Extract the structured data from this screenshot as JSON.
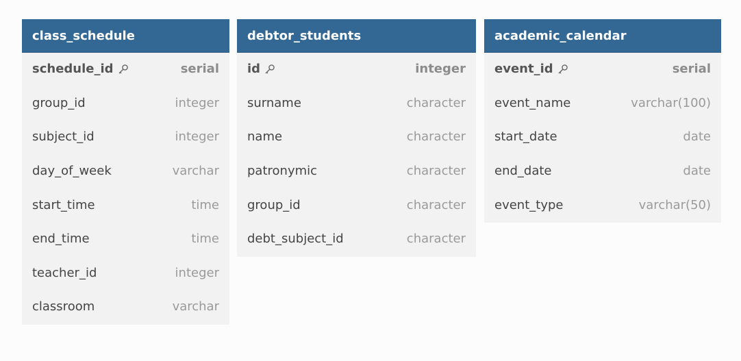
{
  "tables": [
    {
      "id": "t-class",
      "name": "class_schedule",
      "columns": [
        {
          "name": "schedule_id",
          "type": "serial",
          "pk": true
        },
        {
          "name": "group_id",
          "type": "integer",
          "pk": false
        },
        {
          "name": "subject_id",
          "type": "integer",
          "pk": false
        },
        {
          "name": "day_of_week",
          "type": "varchar",
          "pk": false
        },
        {
          "name": "start_time",
          "type": "time",
          "pk": false
        },
        {
          "name": "end_time",
          "type": "time",
          "pk": false
        },
        {
          "name": "teacher_id",
          "type": "integer",
          "pk": false
        },
        {
          "name": "classroom",
          "type": "varchar",
          "pk": false
        }
      ]
    },
    {
      "id": "t-debtor",
      "name": "debtor_students",
      "columns": [
        {
          "name": "id",
          "type": "integer",
          "pk": true
        },
        {
          "name": "surname",
          "type": "character",
          "pk": false
        },
        {
          "name": "name",
          "type": "character",
          "pk": false
        },
        {
          "name": "patronymic",
          "type": "character",
          "pk": false
        },
        {
          "name": "group_id",
          "type": "character",
          "pk": false
        },
        {
          "name": "debt_subject_id",
          "type": "character",
          "pk": false
        }
      ]
    },
    {
      "id": "t-academic",
      "name": "academic_calendar",
      "columns": [
        {
          "name": "event_id",
          "type": "serial",
          "pk": true
        },
        {
          "name": "event_name",
          "type": "varchar(100)",
          "pk": false
        },
        {
          "name": "start_date",
          "type": "date",
          "pk": false
        },
        {
          "name": "end_date",
          "type": "date",
          "pk": false
        },
        {
          "name": "event_type",
          "type": "varchar(50)",
          "pk": false
        }
      ]
    }
  ],
  "colors": {
    "header_bg": "#336794",
    "header_text": "#ffffff",
    "body_bg": "#f2f2f2",
    "page_bg": "#fcfcfc"
  },
  "icons": {
    "primary_key": "key-icon"
  }
}
